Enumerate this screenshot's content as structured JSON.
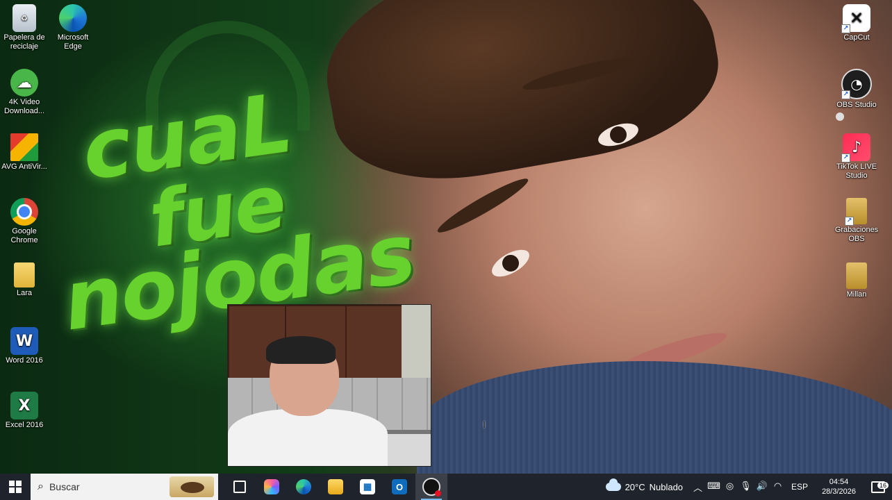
{
  "wallpaper": {
    "text_lines": [
      "cuaL",
      "fue",
      "nojodas"
    ]
  },
  "desktop_icons_left": [
    {
      "label": "Papelera de reciclaje",
      "icon": "recycle-bin-icon",
      "glyph": "♻",
      "cls": "ic-recycle",
      "shortcut": false
    },
    {
      "label": "Microsoft Edge",
      "icon": "edge-icon",
      "glyph": "",
      "cls": "ic-edge",
      "shortcut": true
    },
    {
      "label": "4K Video Download...",
      "icon": "4k-video-downloader-icon",
      "glyph": "☁",
      "cls": "ic-4k",
      "shortcut": true
    },
    {
      "label": "AVG AntiVir...",
      "icon": "avg-antivirus-icon",
      "glyph": "",
      "cls": "ic-avg",
      "shortcut": true
    },
    {
      "label": "Google Chrome",
      "icon": "chrome-icon",
      "glyph": "",
      "cls": "ic-chrome",
      "shortcut": true
    },
    {
      "label": "Lara",
      "icon": "folder-icon",
      "glyph": "",
      "cls": "ic-folder",
      "shortcut": false
    },
    {
      "label": "Word 2016",
      "icon": "word-icon",
      "glyph": "W",
      "cls": "ic-word",
      "shortcut": true
    },
    {
      "label": "Excel 2016",
      "icon": "excel-icon",
      "glyph": "X",
      "cls": "ic-excel",
      "shortcut": true
    }
  ],
  "desktop_icons_right": [
    {
      "label": "CapCut",
      "icon": "capcut-icon",
      "glyph": "✕",
      "cls": "ic-capcut",
      "shortcut": true
    },
    {
      "label": "OBS Studio",
      "icon": "obs-studio-icon",
      "glyph": "◔",
      "cls": "ic-obs",
      "shortcut": true
    },
    {
      "label": "TikTok LIVE Studio",
      "icon": "tiktok-live-studio-icon",
      "glyph": "♪",
      "cls": "ic-tiktok",
      "shortcut": true
    },
    {
      "label": "Grabaciones OBS",
      "icon": "folder-icon",
      "glyph": "",
      "cls": "ic-folder2",
      "shortcut": true
    },
    {
      "label": "Millan",
      "icon": "folder-icon",
      "glyph": "",
      "cls": "ic-folder2",
      "shortcut": false
    }
  ],
  "taskbar": {
    "search_placeholder": "Buscar",
    "apps": [
      {
        "name": "task-view-button",
        "icon": "task-view-icon",
        "cls": "g-taskview",
        "glyph": "",
        "active": false
      },
      {
        "name": "copilot-button",
        "icon": "copilot-icon",
        "cls": "g-copilot",
        "glyph": "",
        "active": false
      },
      {
        "name": "edge-taskbar-button",
        "icon": "edge-icon",
        "cls": "g-edge",
        "glyph": "",
        "active": false
      },
      {
        "name": "file-explorer-button",
        "icon": "folder-icon",
        "cls": "g-explorer",
        "glyph": "",
        "active": false
      },
      {
        "name": "microsoft-store-button",
        "icon": "store-icon",
        "cls": "g-store",
        "glyph": "▦",
        "active": false
      },
      {
        "name": "outlook-button",
        "icon": "outlook-icon",
        "cls": "g-outlook",
        "glyph": "O",
        "active": false
      },
      {
        "name": "obs-taskbar-button",
        "icon": "obs-recording-icon",
        "cls": "g-obs",
        "glyph": "",
        "active": true
      }
    ],
    "weather": {
      "temp": "20°C",
      "condition": "Nublado"
    },
    "tray_icons": [
      {
        "name": "chevron-up-icon",
        "glyph": "︿"
      },
      {
        "name": "input-indicator-icon",
        "glyph": "⌨"
      },
      {
        "name": "webcam-icon",
        "glyph": "◎"
      },
      {
        "name": "microphone-icon",
        "glyph": "🎙"
      },
      {
        "name": "volume-icon",
        "glyph": "🔊"
      },
      {
        "name": "wifi-icon",
        "glyph": "◠"
      }
    ],
    "language": "ESP",
    "time": "04:54",
    "date": "28/3/2026",
    "notification_count": "16"
  }
}
